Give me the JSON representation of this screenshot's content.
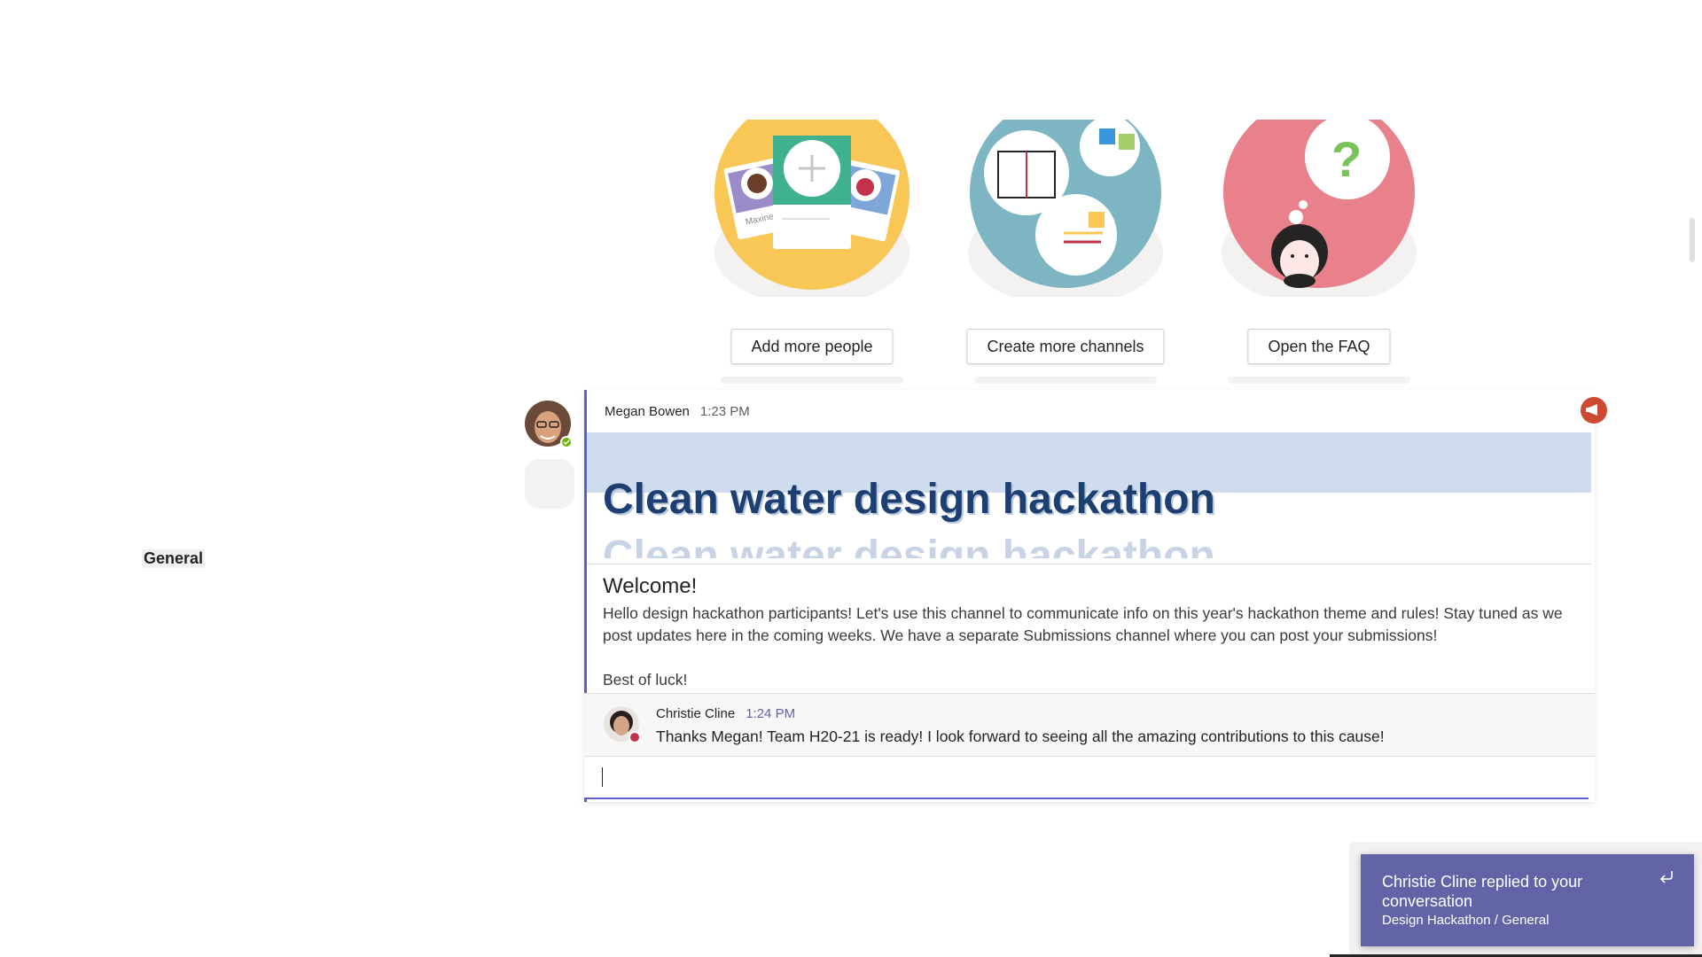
{
  "channel": {
    "name": "General"
  },
  "cards": [
    {
      "button": "Add more people",
      "card_label_1": "Maxine"
    },
    {
      "button": "Create more channels"
    },
    {
      "button": "Open the FAQ"
    }
  ],
  "post": {
    "author": "Megan Bowen",
    "time": "1:23 PM",
    "headline": "Clean water design hackathon",
    "welcome_title": "Welcome!",
    "body_p1": "Hello design hackathon participants! Let's use this channel to communicate info on this year's hackathon theme and rules! Stay tuned as we post updates here in the coming weeks. We have a separate Submissions channel where you can post your submissions!",
    "body_p2": "Best of luck!",
    "reply": {
      "author": "Christie Cline",
      "time": "1:24 PM",
      "text": "Thanks Megan! Team H20-21 is ready! I look forward to seeing all the amazing contributions to this cause!"
    }
  },
  "toast": {
    "title": "Christie Cline replied to your conversation",
    "subtitle": "Design Hackathon / General"
  },
  "colors": {
    "accent": "#6264a7",
    "announcement": "#cc4a31",
    "banner": "#cfdced",
    "headline": "#1d3f72",
    "presence_available": "#6bb700",
    "presence_busy": "#c4314b"
  },
  "icons": [
    "megaphone-icon",
    "reply-arrow-icon",
    "presence-available-icon",
    "presence-busy-icon"
  ]
}
